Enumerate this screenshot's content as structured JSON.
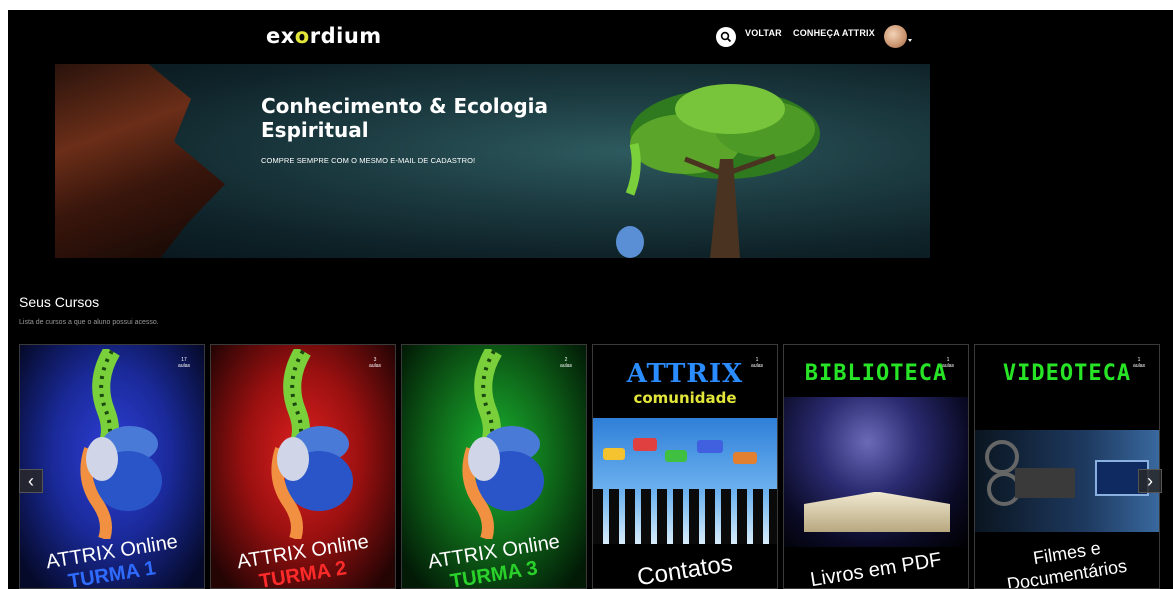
{
  "header": {
    "logo": "exordium",
    "nav": [
      {
        "label": "VOLTAR"
      },
      {
        "label": "CONHEÇA ATTRIX"
      }
    ],
    "icons": {
      "search": "search-icon",
      "avatar": "user-avatar",
      "menu": "chevron-down-icon"
    }
  },
  "banner": {
    "title_line1": "Conhecimento & Ecologia",
    "title_line2": "Espiritual",
    "subtitle": "COMPRE SEMPRE COM O MESMO E-MAIL DE CADASTRO!"
  },
  "section": {
    "title": "Seus Cursos",
    "subtitle": "Lista de cursos a que o aluno possui acesso."
  },
  "courses": [
    {
      "count": "17",
      "unit": "aulas",
      "line1": "ATTRIX Online",
      "line2": "TURMA 1",
      "accent": "#2f6bff",
      "bg": "#1a2a9a"
    },
    {
      "count": "3",
      "unit": "aulas",
      "line1": "ATTRIX Online",
      "line2": "TURMA 2",
      "accent": "#ff2a2a",
      "bg": "#9a1010"
    },
    {
      "count": "2",
      "unit": "aulas",
      "line1": "ATTRIX Online",
      "line2": "TURMA 3",
      "accent": "#2bd12b",
      "bg": "#0f6a1a"
    },
    {
      "count": "1",
      "unit": "aulas",
      "header1": "ATTRIX",
      "header2": "comunidade",
      "caption": "Contatos",
      "accent": "#2a8cff"
    },
    {
      "count": "1",
      "unit": "aulas",
      "header1": "BIBLIOTECA",
      "caption": "Livros em PDF",
      "accent": "#27e427"
    },
    {
      "count": "1",
      "unit": "aulas",
      "header1": "VIDEOTECA",
      "caption_line1": "Filmes e",
      "caption_line2": "Documentários",
      "accent": "#27e427"
    }
  ],
  "carousel": {
    "prev": "‹",
    "next": "›"
  }
}
